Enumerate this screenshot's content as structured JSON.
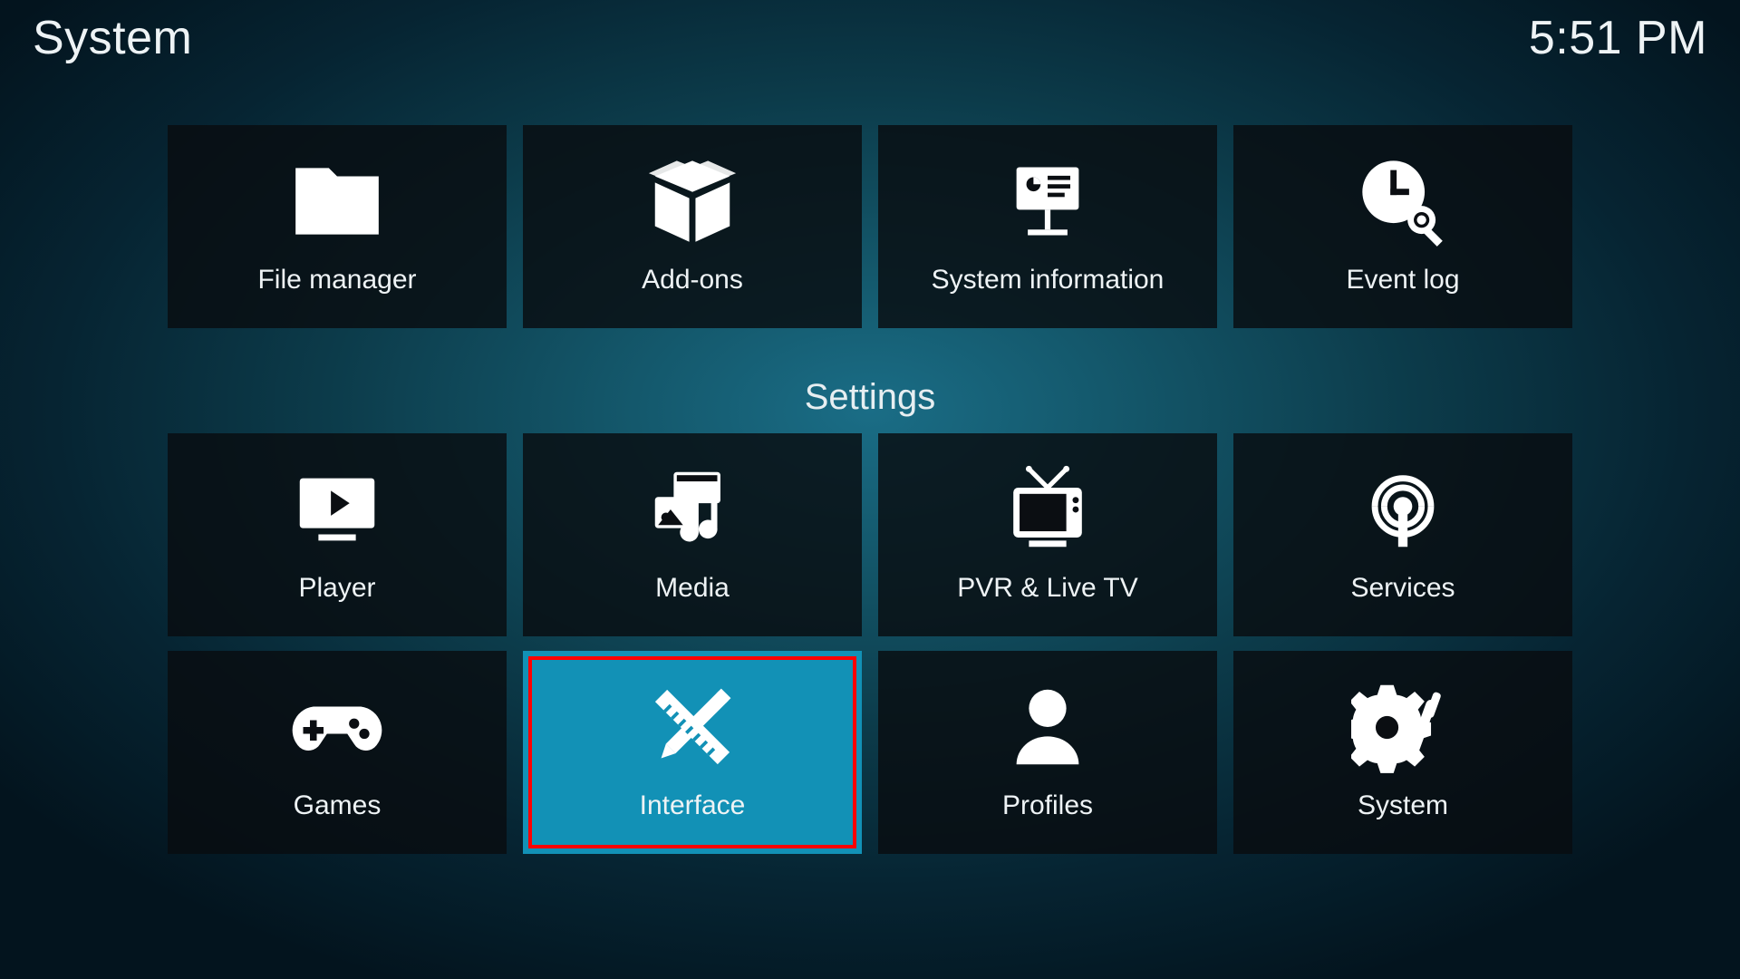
{
  "header": {
    "title": "System",
    "time": "5:51 PM"
  },
  "section_label": "Settings",
  "tiles": {
    "file_manager": {
      "label": "File manager"
    },
    "addons": {
      "label": "Add-ons"
    },
    "system_information": {
      "label": "System information"
    },
    "event_log": {
      "label": "Event log"
    },
    "player": {
      "label": "Player"
    },
    "media": {
      "label": "Media"
    },
    "pvr": {
      "label": "PVR & Live TV"
    },
    "services": {
      "label": "Services"
    },
    "games": {
      "label": "Games"
    },
    "interface": {
      "label": "Interface",
      "selected": true,
      "annotated": true
    },
    "profiles": {
      "label": "Profiles"
    },
    "system": {
      "label": "System"
    }
  }
}
